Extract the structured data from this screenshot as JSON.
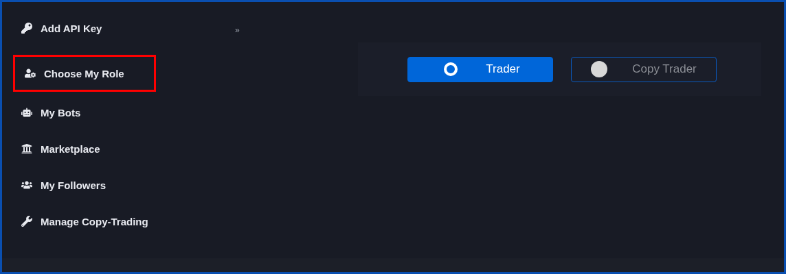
{
  "sidebar": {
    "collapse_toggle": "»",
    "items": [
      {
        "label": "Add API Key",
        "highlighted": false
      },
      {
        "label": "Choose My Role",
        "highlighted": true
      },
      {
        "label": "My Bots",
        "highlighted": false
      },
      {
        "label": "Marketplace",
        "highlighted": false
      },
      {
        "label": "My Followers",
        "highlighted": false
      },
      {
        "label": "Manage Copy-Trading",
        "highlighted": false
      }
    ]
  },
  "role_options": [
    {
      "label": "Trader",
      "selected": true
    },
    {
      "label": "Copy Trader",
      "selected": false
    }
  ]
}
